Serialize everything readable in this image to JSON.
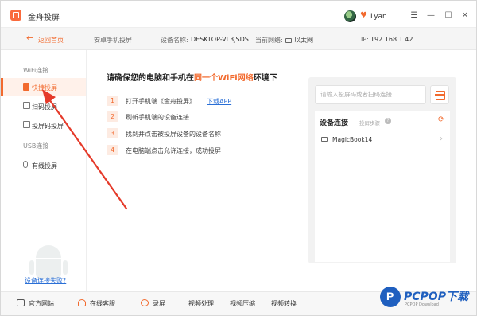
{
  "app": {
    "title": "金舟投屏",
    "username": "Lyan"
  },
  "window_controls": {
    "menu": "☰",
    "minimize": "—",
    "maximize": "☐",
    "close": "✕"
  },
  "subheader": {
    "back_label": "返回首页",
    "mode": "安卓手机投屏",
    "device_name_label": "设备名称:",
    "device_name": "DESKTOP-VL3JSDS",
    "network_label": "当前网络:",
    "network": "以太网",
    "ip_label": "IP:",
    "ip": "192.168.1.42"
  },
  "sidebar": {
    "wifi_group": "WiFi连接",
    "items": [
      {
        "label": "快捷投屏",
        "active": true
      },
      {
        "label": "扫码投屏",
        "active": false
      },
      {
        "label": "投屏码投屏",
        "active": false
      }
    ],
    "usb_group": "USB连接",
    "usb_items": [
      {
        "label": "有线投屏"
      }
    ],
    "failed_link": "设备连接失败?"
  },
  "main": {
    "title_prefix": "请确保您的电脑和手机在",
    "title_highlight": "同一个WiFi网络",
    "title_suffix": "环境下",
    "steps": [
      {
        "num": "1",
        "text": "打开手机端《金舟投屏》",
        "link": "下载APP"
      },
      {
        "num": "2",
        "text": "刷新手机端的设备连接"
      },
      {
        "num": "3",
        "text": "找到并点击被投屏设备的设备名称"
      },
      {
        "num": "4",
        "text": "在电脑端点击允许连接，成功投屏"
      }
    ]
  },
  "panel": {
    "search_placeholder": "请输入投屏码或者扫码连接",
    "device_connect_title": "设备连接",
    "device_connect_sub": "投屏步骤",
    "devices": [
      {
        "name": "MagicBook14"
      }
    ]
  },
  "bottombar": {
    "items": [
      "官方网站",
      "在线客服",
      "录屏",
      "视频处理",
      "视频压缩",
      "视频转换"
    ]
  },
  "watermark": {
    "text": "PCPOP下载",
    "sub": "PCPOP Download"
  },
  "colors": {
    "accent": "#f26a2e",
    "link": "#2a6fd6",
    "annotation_arrow": "#e53a2a"
  }
}
